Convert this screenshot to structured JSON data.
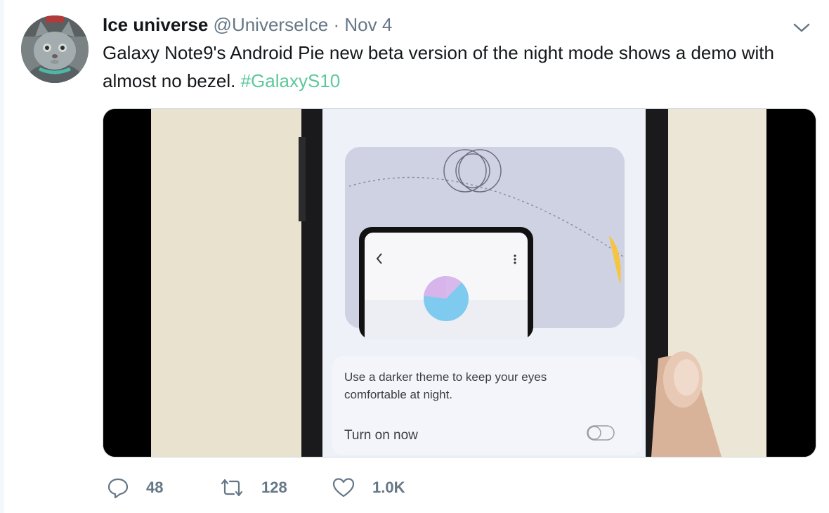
{
  "tweet": {
    "author_name": "Ice universe",
    "handle": "@UniverseIce",
    "separator": "·",
    "date": "Nov 4",
    "text": "Galaxy Note9's Android Pie new beta version of the night mode shows a demo with almost no bezel.",
    "hashtag": "#GalaxyS10",
    "hashtag_color": "#5dc89a"
  },
  "media": {
    "description_line1": "Use a darker theme to keep your eyes",
    "description_line2": "comfortable at night.",
    "toggle_label": "Turn on now",
    "toggle_state": "off"
  },
  "actions": {
    "replies": "48",
    "retweets": "128",
    "likes": "1.0K"
  },
  "icons": [
    "avatar-cat",
    "chevron-down-icon",
    "reply-icon",
    "retweet-icon",
    "like-icon"
  ]
}
